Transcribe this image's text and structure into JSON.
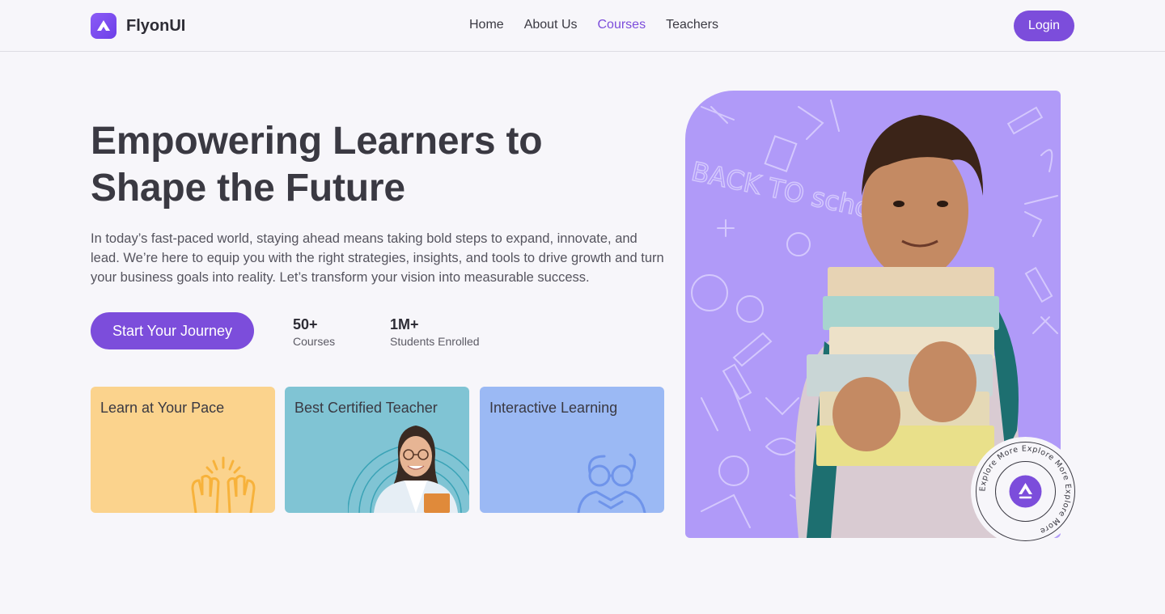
{
  "brand": {
    "name": "FlyonUI",
    "logo_icon": "flyonui-logo-icon",
    "accent": "#7c4ddb"
  },
  "nav": {
    "items": [
      {
        "label": "Home",
        "active": false
      },
      {
        "label": "About Us",
        "active": false
      },
      {
        "label": "Courses",
        "active": true
      },
      {
        "label": "Teachers",
        "active": false
      }
    ],
    "login_label": "Login"
  },
  "hero": {
    "headline_line1": "Empowering Learners to",
    "headline_line2": "Shape the Future",
    "description": "In today’s fast-paced world, staying ahead means taking bold steps to expand, innovate, and lead. We’re here to equip you with the right strategies, insights, and tools to drive growth and turn your business goals into reality. Let’s transform your vision into measurable success.",
    "cta_label": "Start Your Journey",
    "stats": [
      {
        "value": "50+",
        "label": "Courses"
      },
      {
        "value": "1M+",
        "label": "Students Enrolled"
      }
    ]
  },
  "cards": [
    {
      "title": "Learn at Your Pace",
      "icon": "high-five-hands-icon",
      "color": "#fbd38d"
    },
    {
      "title": "Best Certified Teacher",
      "icon": "teacher-portrait",
      "color": "#80c4d4"
    },
    {
      "title": "Interactive Learning",
      "icon": "reading-glasses-icon",
      "color": "#9bb9f4"
    }
  ],
  "hero_image": {
    "alt_subject": "student-holding-books",
    "background": "#b09af8",
    "doodle_text": "BACK TO school"
  },
  "explore_badge": {
    "ring_text": "Explore More Explore More Explore More",
    "icon": "flyonui-logo-icon"
  }
}
